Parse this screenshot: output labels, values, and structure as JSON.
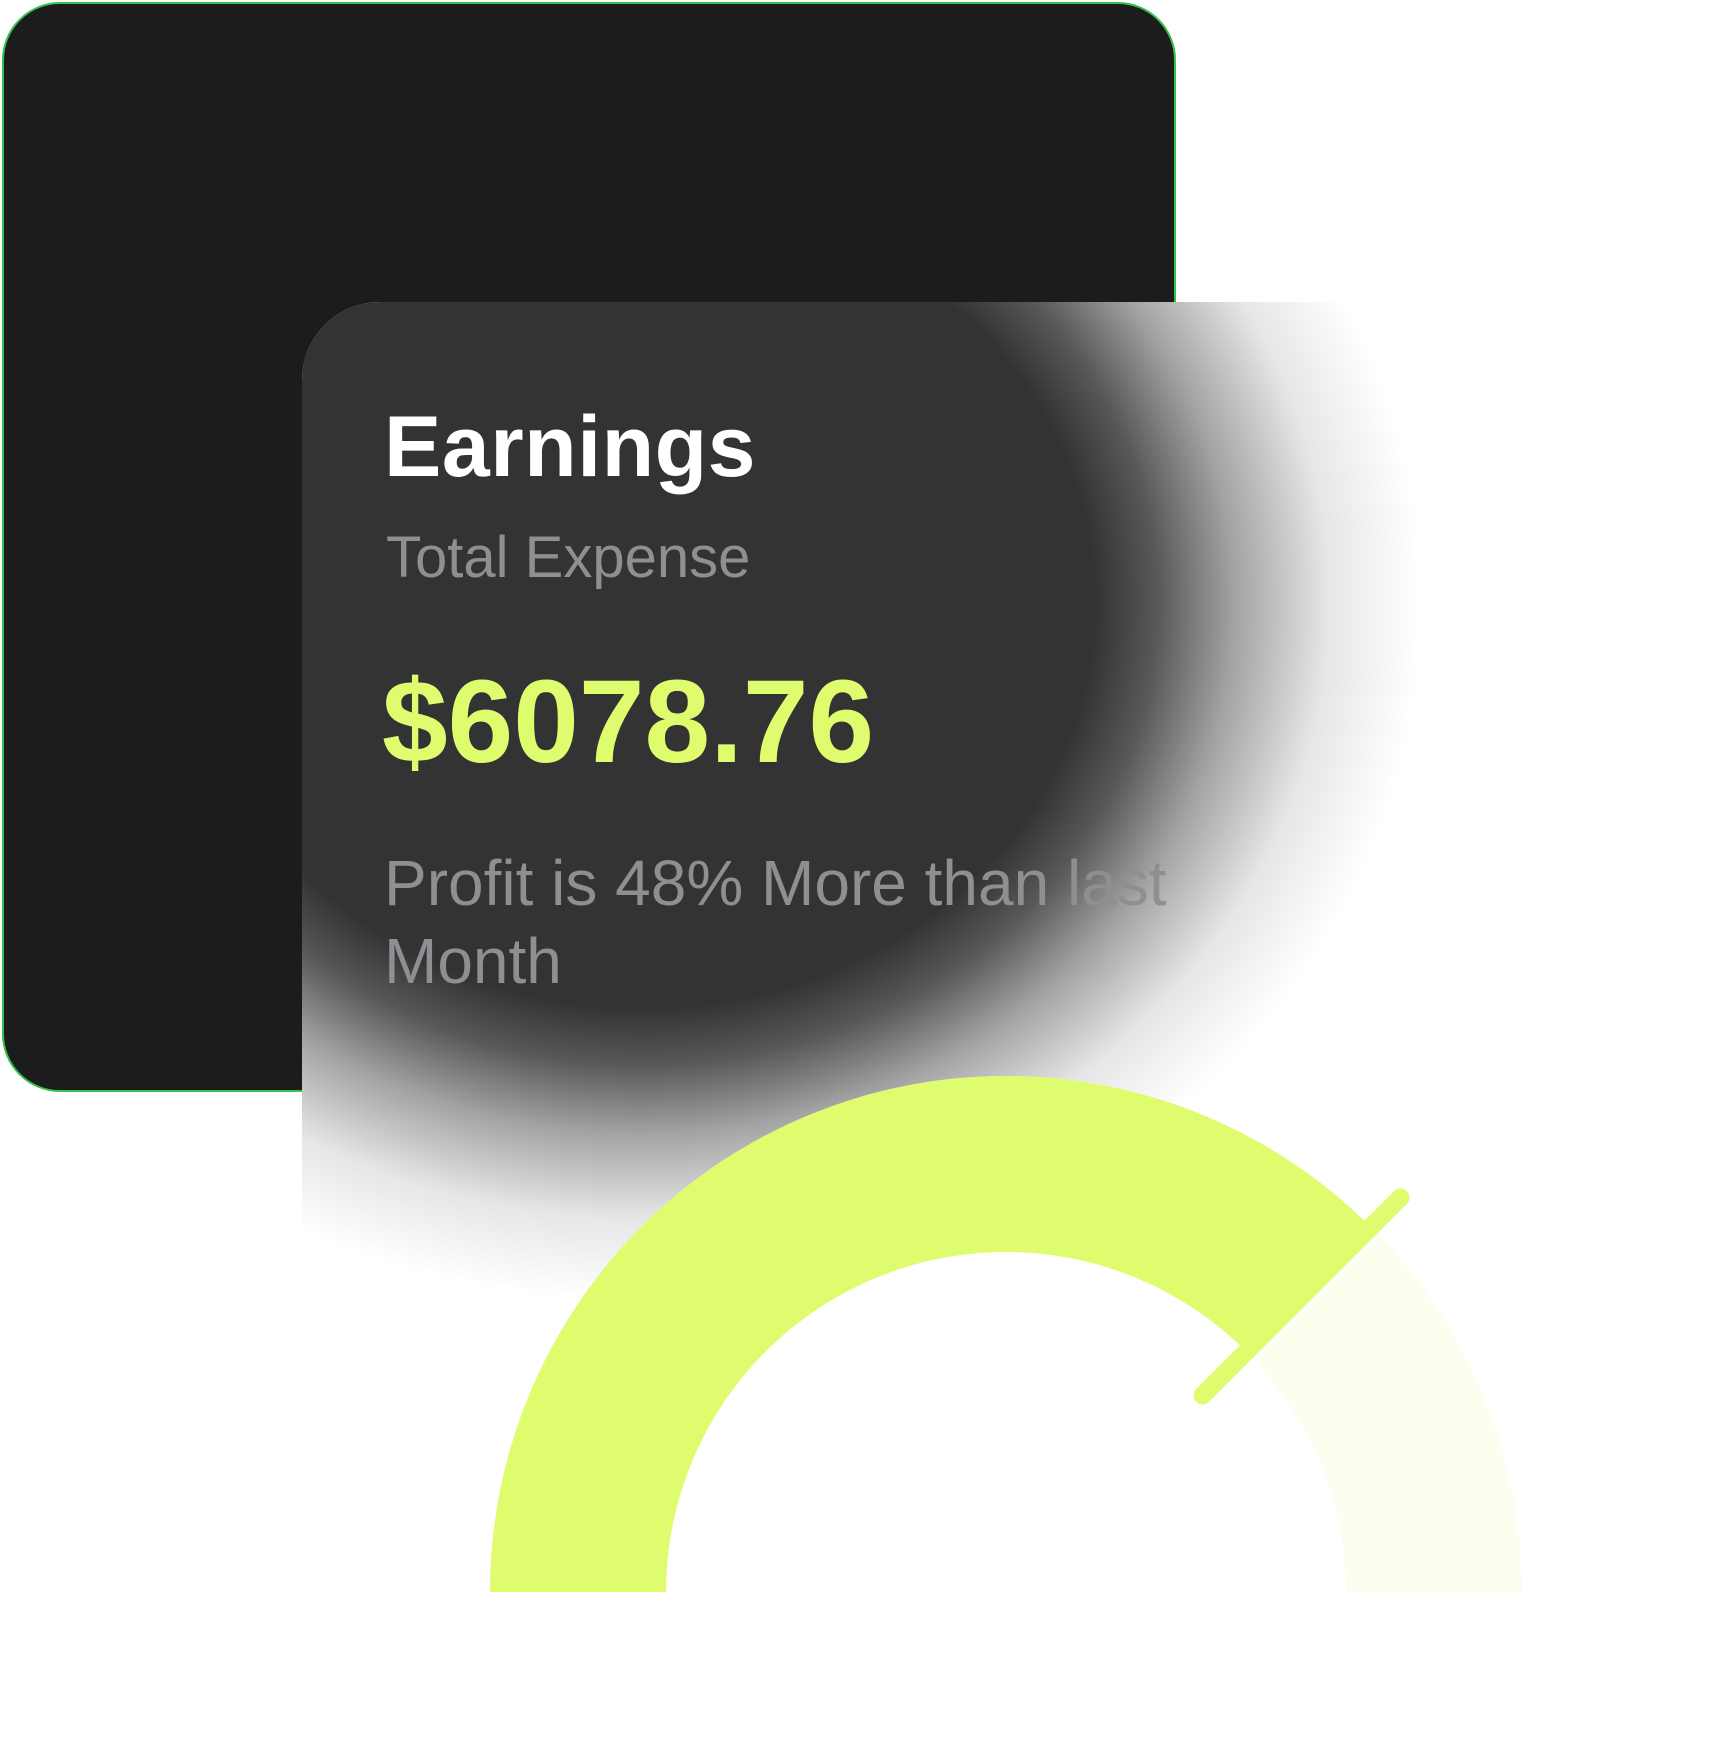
{
  "card": {
    "title": "Earnings",
    "subtitle": "Total Expense",
    "amount": "$6078.76",
    "profit_text": "Profit is 48% More than last Month"
  },
  "gauge": {
    "progress_fraction": 0.75,
    "fill_color": "#dffc6e",
    "track_color": "#fbfff0"
  },
  "colors": {
    "back_card": "#1c1c1c",
    "back_card_border": "#35c24a",
    "front_card": "#333333",
    "accent": "#dffc6e",
    "muted_text": "#8e8e93"
  }
}
